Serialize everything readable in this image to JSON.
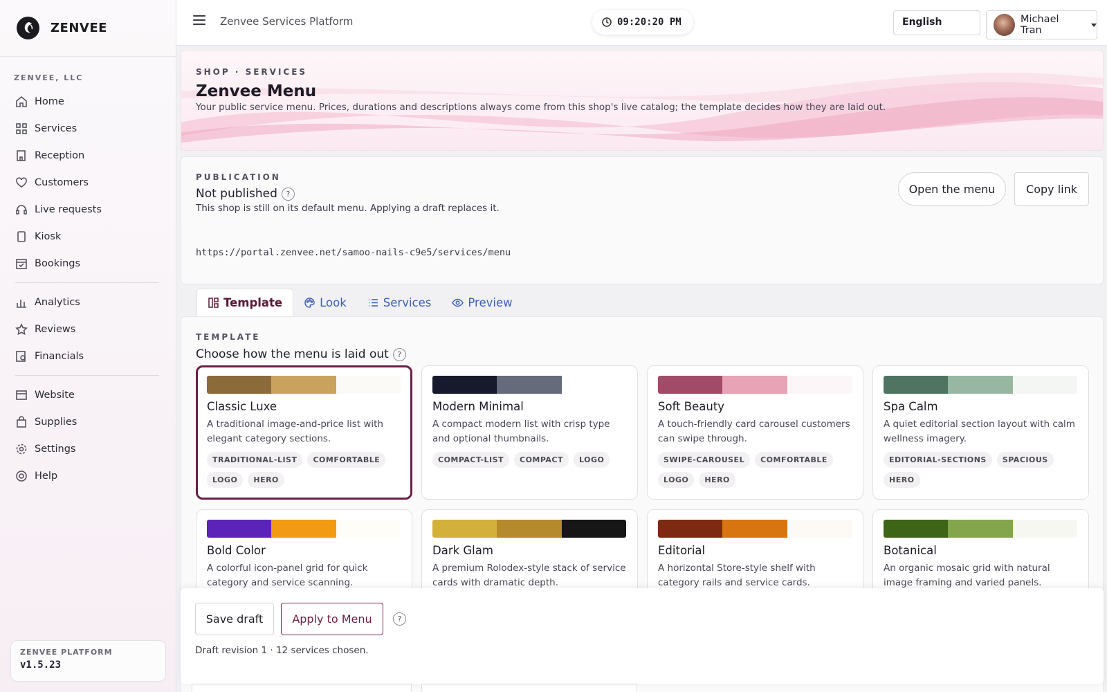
{
  "brand": {
    "name": "ZENVEE"
  },
  "sidebar": {
    "org_label": "ZENVEE, LLC",
    "group1": [
      {
        "label": "Home",
        "icon": "home-icon"
      },
      {
        "label": "Services",
        "icon": "grid-icon"
      },
      {
        "label": "Reception",
        "icon": "desk-icon"
      },
      {
        "label": "Customers",
        "icon": "heart-icon"
      },
      {
        "label": "Live requests",
        "icon": "headset-icon"
      },
      {
        "label": "Kiosk",
        "icon": "tablet-icon"
      },
      {
        "label": "Bookings",
        "icon": "calendar-check-icon"
      }
    ],
    "group2": [
      {
        "label": "Analytics",
        "icon": "bar-chart-icon"
      },
      {
        "label": "Reviews",
        "icon": "star-icon"
      },
      {
        "label": "Financials",
        "icon": "receipt-icon"
      }
    ],
    "group3": [
      {
        "label": "Website",
        "icon": "browser-icon"
      },
      {
        "label": "Supplies",
        "icon": "bag-icon"
      },
      {
        "label": "Settings",
        "icon": "gear-icon"
      },
      {
        "label": "Help",
        "icon": "lifebuoy-icon"
      }
    ],
    "platform_label": "ZENVEE PLATFORM",
    "platform_version": "v1.5.23"
  },
  "topbar": {
    "title": "Zenvee Services Platform",
    "clock": "09:20:20 PM",
    "language": "English",
    "user_name": "Michael Tran"
  },
  "hero": {
    "breadcrumb": "SHOP · SERVICES",
    "title": "Zenvee Menu",
    "subtitle": "Your public service menu. Prices, durations and descriptions always come from this shop's live catalog; the template decides how they are laid out."
  },
  "publication": {
    "label": "PUBLICATION",
    "status": "Not published",
    "description": "This shop is still on its default menu. Applying a draft replaces it.",
    "url": "https://portal.zenvee.net/samoo-nails-c9e5/services/menu",
    "open_label": "Open the menu",
    "copy_label": "Copy link"
  },
  "tabs": [
    {
      "label": "Template",
      "icon": "layout-icon"
    },
    {
      "label": "Look",
      "icon": "palette-icon"
    },
    {
      "label": "Services",
      "icon": "list-icon"
    },
    {
      "label": "Preview",
      "icon": "eye-icon"
    }
  ],
  "template": {
    "label": "TEMPLATE",
    "title": "Choose how the menu is laid out",
    "cards": [
      {
        "name": "Classic Luxe",
        "description": "A traditional image-and-price list with elegant category sections.",
        "tags": [
          "TRADITIONAL-LIST",
          "COMFORTABLE",
          "LOGO",
          "HERO"
        ],
        "colors": [
          "#8b6b3a",
          "#c9a35e",
          "#fbfaf7"
        ]
      },
      {
        "name": "Modern Minimal",
        "description": "A compact modern list with crisp type and optional thumbnails.",
        "tags": [
          "COMPACT-LIST",
          "COMPACT",
          "LOGO"
        ],
        "colors": [
          "#161a2c",
          "#656b7b",
          "#ffffff"
        ]
      },
      {
        "name": "Soft Beauty",
        "description": "A touch-friendly card carousel customers can swipe through.",
        "tags": [
          "SWIPE-CAROUSEL",
          "COMFORTABLE",
          "LOGO",
          "HERO"
        ],
        "colors": [
          "#a24b68",
          "#e8a3b6",
          "#fcf6f8"
        ]
      },
      {
        "name": "Spa Calm",
        "description": "A quiet editorial section layout with calm wellness imagery.",
        "tags": [
          "EDITORIAL-SECTIONS",
          "SPACIOUS",
          "HERO"
        ],
        "colors": [
          "#4f7562",
          "#98b7a3",
          "#f4f6f3"
        ]
      },
      {
        "name": "Bold Color",
        "description": "A colorful icon-panel grid for quick category and service scanning.",
        "tags": [],
        "colors": [
          "#5b23b8",
          "#f29a12",
          "#fffdf7"
        ]
      },
      {
        "name": "Dark Glam",
        "description": "A premium Rolodex-style stack of service cards with dramatic depth.",
        "tags": [],
        "colors": [
          "#d3b03a",
          "#b58a2c",
          "#161616"
        ]
      },
      {
        "name": "Editorial",
        "description": "A horizontal Store-style shelf with category rails and service cards.",
        "tags": [],
        "colors": [
          "#7e2a13",
          "#d87510",
          "#fdfaf5"
        ]
      },
      {
        "name": "Botanical",
        "description": "An organic mosaic grid with natural image framing and varied panels.",
        "tags": [],
        "colors": [
          "#3e6418",
          "#83a54c",
          "#f6f7f1"
        ]
      }
    ],
    "selected_index": 0
  },
  "savebar": {
    "save_label": "Save draft",
    "apply_label": "Apply to Menu",
    "draft_info": "Draft revision 1 · 12 services chosen."
  }
}
